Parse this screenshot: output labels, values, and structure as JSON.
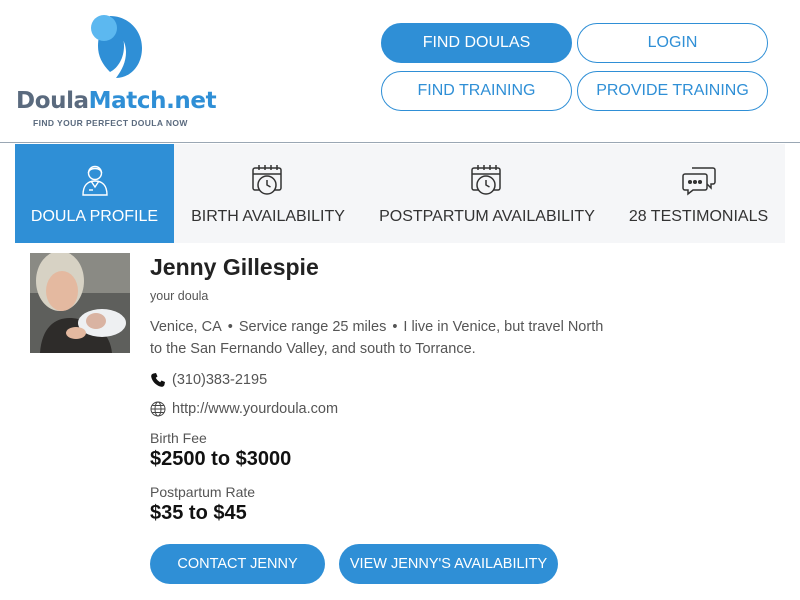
{
  "brand": {
    "name_part1": "Doula",
    "name_part2": "Match.net",
    "tagline": "FIND YOUR PERFECT DOULA NOW",
    "colors": {
      "primary": "#2f8fd6",
      "secondary": "#5a6a7e",
      "light": "#5cb8f0"
    }
  },
  "nav": {
    "find_doulas": "FIND DOULAS",
    "login": "LOGIN",
    "find_training": "FIND TRAINING",
    "provide_training": "PROVIDE TRAINING"
  },
  "tabs": [
    {
      "label": "DOULA PROFILE",
      "icon": "person-icon",
      "active": true
    },
    {
      "label": "BIRTH AVAILABILITY",
      "icon": "calendar-clock-icon",
      "active": false
    },
    {
      "label": "POSTPARTUM AVAILABILITY",
      "icon": "calendar-clock-icon",
      "active": false
    },
    {
      "label": "28 TESTIMONIALS",
      "icon": "chat-bubbles-icon",
      "active": false
    }
  ],
  "profile": {
    "name": "Jenny Gillespie",
    "role": "your doula",
    "location": "Venice, CA",
    "service_range": "Service range 25 miles",
    "bio_part1": "I live in Venice, but travel North",
    "bio_part2": "to the San Fernando Valley, and south to Torrance.",
    "phone": "(310)383-2195",
    "website": "http://www.yourdoula.com",
    "birth_fee_label": "Birth Fee",
    "birth_fee": "$2500 to $3000",
    "postpartum_label": "Postpartum Rate",
    "postpartum_rate": "$35 to $45"
  },
  "actions": {
    "contact": "CONTACT JENNY",
    "availability": "VIEW JENNY'S AVAILABILITY"
  }
}
